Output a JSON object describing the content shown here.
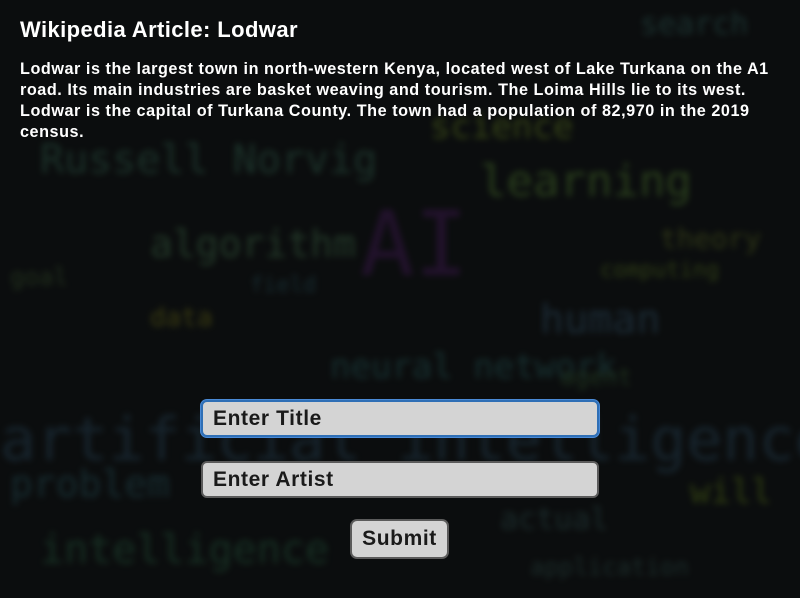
{
  "article": {
    "heading": "Wikipedia Article: Lodwar",
    "body": "Lodwar is the largest town in north-western Kenya, located west of Lake Turkana on the A1 road. Its main industries are basket weaving and tourism. The Loima Hills lie to its west. Lodwar is the capital of Turkana County. The town had a population of 82,970 in the 2019 census."
  },
  "form": {
    "title_placeholder": "Enter Title",
    "artist_placeholder": "Enter Artist",
    "title_value": "",
    "artist_value": "",
    "submit_label": "Submit"
  },
  "background_words": [
    {
      "text": "Russell Norvig",
      "color": "#3b6f5a"
    },
    {
      "text": "learning",
      "color": "#5d8f3a"
    },
    {
      "text": "science",
      "color": "#7a9a2a"
    },
    {
      "text": "AI",
      "color": "#4a1f5f"
    },
    {
      "text": "algorithm",
      "color": "#4d7f56"
    },
    {
      "text": "data",
      "color": "#8a8a1f"
    },
    {
      "text": "human",
      "color": "#3a5f7a"
    },
    {
      "text": "theory",
      "color": "#6a7a2a"
    },
    {
      "text": "computing",
      "color": "#6a8a2a"
    },
    {
      "text": "neural network",
      "color": "#2f6a6a"
    },
    {
      "text": "artificial intelligence",
      "color": "#2e4d63"
    },
    {
      "text": "problem",
      "color": "#2f5f6a"
    },
    {
      "text": "intelligence",
      "color": "#2f6a4a"
    },
    {
      "text": "will",
      "color": "#6a8a1f"
    },
    {
      "text": "actual",
      "color": "#3a5f5f"
    },
    {
      "text": "application",
      "color": "#3a5f5a"
    },
    {
      "text": "goal",
      "color": "#4a6a3a"
    },
    {
      "text": "field",
      "color": "#2f5f6a"
    },
    {
      "text": "agent",
      "color": "#3f6a3a"
    },
    {
      "text": "search",
      "color": "#3a6f6a"
    }
  ],
  "colors": {
    "page_background": "#101314",
    "text": "#ffffff",
    "field_background": "#d4d4d4",
    "field_focus_border": "#2f6fb6"
  }
}
